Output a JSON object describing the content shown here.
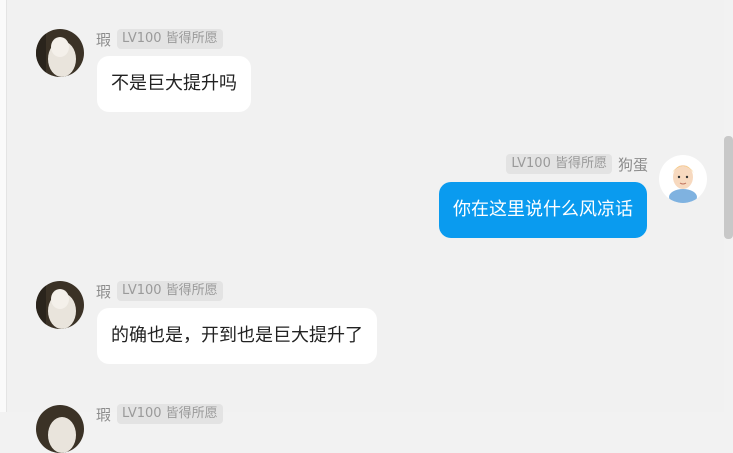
{
  "messages": [
    {
      "nick": "瑕",
      "badge": "LV100 皆得所愿",
      "text": "不是巨大提升吗",
      "side": "in"
    },
    {
      "nick": "狗蛋",
      "badge": "LV100 皆得所愿",
      "text": "你在这里说什么风凉话",
      "side": "out"
    },
    {
      "nick": "瑕",
      "badge": "LV100 皆得所愿",
      "text": "的确也是，开到也是巨大提升了",
      "side": "in"
    },
    {
      "nick": "瑕",
      "badge": "LV100 皆得所愿",
      "side": "in"
    }
  ],
  "colors": {
    "out_bubble": "#0a9bef",
    "in_bubble": "#ffffff",
    "background": "#f1f1f1"
  }
}
